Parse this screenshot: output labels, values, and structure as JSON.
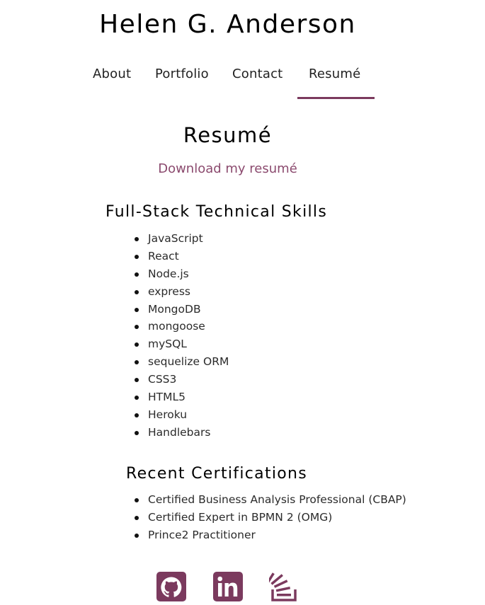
{
  "header": {
    "title": "Helen G. Anderson"
  },
  "nav": {
    "items": [
      {
        "label": "About"
      },
      {
        "label": "Portfolio"
      },
      {
        "label": "Contact"
      },
      {
        "label": "Resumé"
      }
    ],
    "active_index": 3
  },
  "main": {
    "heading": "Resumé",
    "download_link": "Download my resumé",
    "skills": {
      "heading": "Full-Stack Technical Skills",
      "items": [
        "JavaScript",
        "React",
        "Node.js",
        "express",
        "MongoDB",
        "mongoose",
        "mySQL",
        "sequelize ORM",
        "CSS3",
        "HTML5",
        "Heroku",
        "Handlebars"
      ]
    },
    "certifications": {
      "heading": "Recent Certifications",
      "items": [
        "Certified Business Analysis Professional (CBAP)",
        "Certified Expert in BPMN 2 (OMG)",
        "Prince2 Practitioner"
      ]
    }
  },
  "social": {
    "icons": [
      "github-icon",
      "linkedin-icon",
      "stackoverflow-icon"
    ]
  },
  "colors": {
    "accent": "#7b3a5e",
    "link": "#8b4a6e",
    "text": "#222222"
  }
}
